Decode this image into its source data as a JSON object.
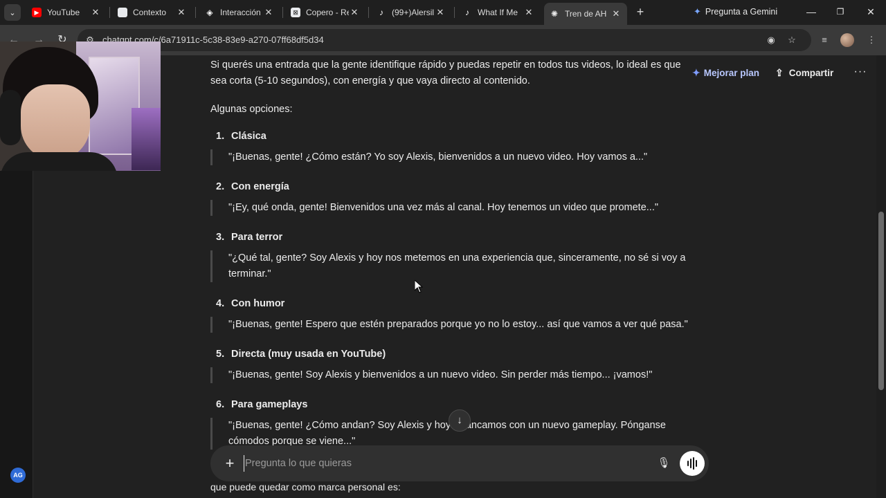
{
  "browser": {
    "tabs": [
      {
        "title": "YouTube",
        "icon": "youtube-icon",
        "color": "#ff0000"
      },
      {
        "title": "Contexto",
        "icon": "docs-icon",
        "color": "#e8eaed"
      },
      {
        "title": "Interacción",
        "icon": "github-icon",
        "color": "#ffffff"
      },
      {
        "title": "Copero - Re",
        "icon": "tool-icon",
        "color": "#e8eaed"
      },
      {
        "title": "(99+)Alersil",
        "icon": "tiktok-icon",
        "color": "#111111"
      },
      {
        "title": "What If Me",
        "icon": "tiktok-icon",
        "color": "#111111"
      },
      {
        "title": "Tren de AH",
        "icon": "chatgpt-icon",
        "color": "#e8eaed"
      }
    ],
    "new_tab": "+",
    "gemini_label": "Pregunta a Gemini",
    "url": "chatgpt.com/c/6a71911c-5c38-83e9-a270-07ff68df5d34"
  },
  "header": {
    "upgrade_label": "Mejorar plan",
    "share_label": "Compartir"
  },
  "chat": {
    "intro": "Si querés una entrada que la gente identifique rápido y puedas repetir en todos tus videos, lo ideal es que sea corta (5-10 segundos), con energía y que vaya directo al contenido.",
    "options_lead": "Algunas opciones:",
    "options": [
      {
        "num": "1.",
        "title": "Clásica",
        "quote": "\"¡Buenas, gente! ¿Cómo están? Yo soy Alexis, bienvenidos a un nuevo video. Hoy vamos a...\""
      },
      {
        "num": "2.",
        "title": "Con energía",
        "quote": "\"¡Ey, qué onda, gente! Bienvenidos una vez más al canal. Hoy tenemos un video que promete...\""
      },
      {
        "num": "3.",
        "title": "Para terror",
        "quote": "\"¿Qué tal, gente? Soy Alexis y hoy nos metemos en una experiencia que, sinceramente, no sé si voy a terminar.\""
      },
      {
        "num": "4.",
        "title": "Con humor",
        "quote": "\"¡Buenas, gente! Espero que estén preparados porque yo no lo estoy... así que vamos a ver qué pasa.\""
      },
      {
        "num": "5.",
        "title": "Directa (muy usada en YouTube)",
        "quote": "\"¡Buenas, gente! Soy Alexis y bienvenidos a un nuevo video. Sin perder más tiempo... ¡vamos!\""
      },
      {
        "num": "6.",
        "title": "Para gameplays",
        "quote": "\"¡Buenas, gente! ¿Cómo andan? Soy Alexis y hoy arrancamos con un nuevo gameplay. Pónganse cómodos porque se viene...\""
      }
    ],
    "trailing": "que puede quedar como marca personal es:"
  },
  "composer": {
    "placeholder": "Pregunta lo que quieras",
    "value": ""
  },
  "user": {
    "initials": "AG"
  }
}
